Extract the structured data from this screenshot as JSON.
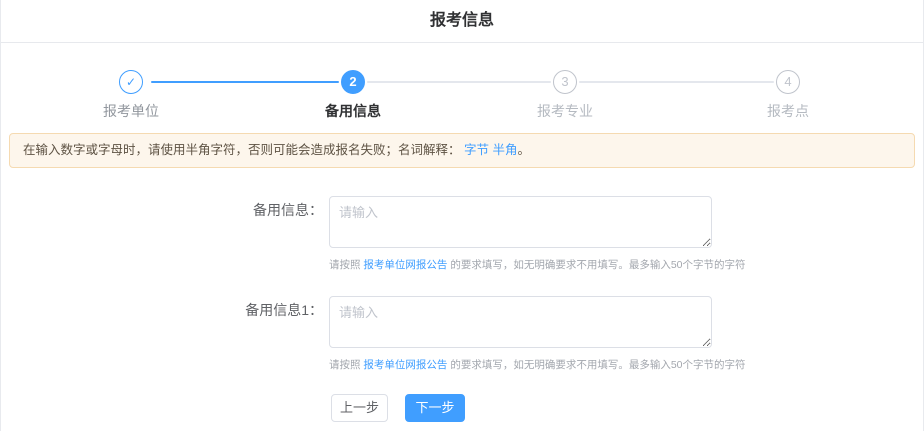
{
  "header": {
    "title": "报考信息"
  },
  "stepper": {
    "steps": [
      {
        "label": "报考单位",
        "symbol": "✓",
        "status": "done"
      },
      {
        "label": "备用信息",
        "symbol": "2",
        "status": "active"
      },
      {
        "label": "报考专业",
        "symbol": "3",
        "status": "wait"
      },
      {
        "label": "报考点",
        "symbol": "4",
        "status": "wait"
      }
    ]
  },
  "alert": {
    "text": "在输入数字或字母时，请使用半角字符，否则可能会造成报名失败；名词解释：",
    "link_byte": "字节",
    "link_halfwidth": "半角",
    "text_end": "。"
  },
  "form": {
    "fields": [
      {
        "label": "备用信息：",
        "placeholder": "请输入",
        "value": "",
        "help_before": "请按照 ",
        "help_link": "报考单位网报公告",
        "help_after": " 的要求填写，如无明确要求不用填写。最多输入50个字节的字符"
      },
      {
        "label": "备用信息1：",
        "placeholder": "请输入",
        "value": "",
        "help_before": "请按照 ",
        "help_link": "报考单位网报公告",
        "help_after": " 的要求填写，如无明确要求不用填写。最多输入50个字节的字符"
      }
    ],
    "prev_label": "上一步",
    "next_label": "下一步"
  },
  "colors": {
    "primary": "#409EFF",
    "alert_bg": "#fdf6ec",
    "alert_border": "#f5dab1",
    "wait_gray": "#c0c4cc"
  }
}
